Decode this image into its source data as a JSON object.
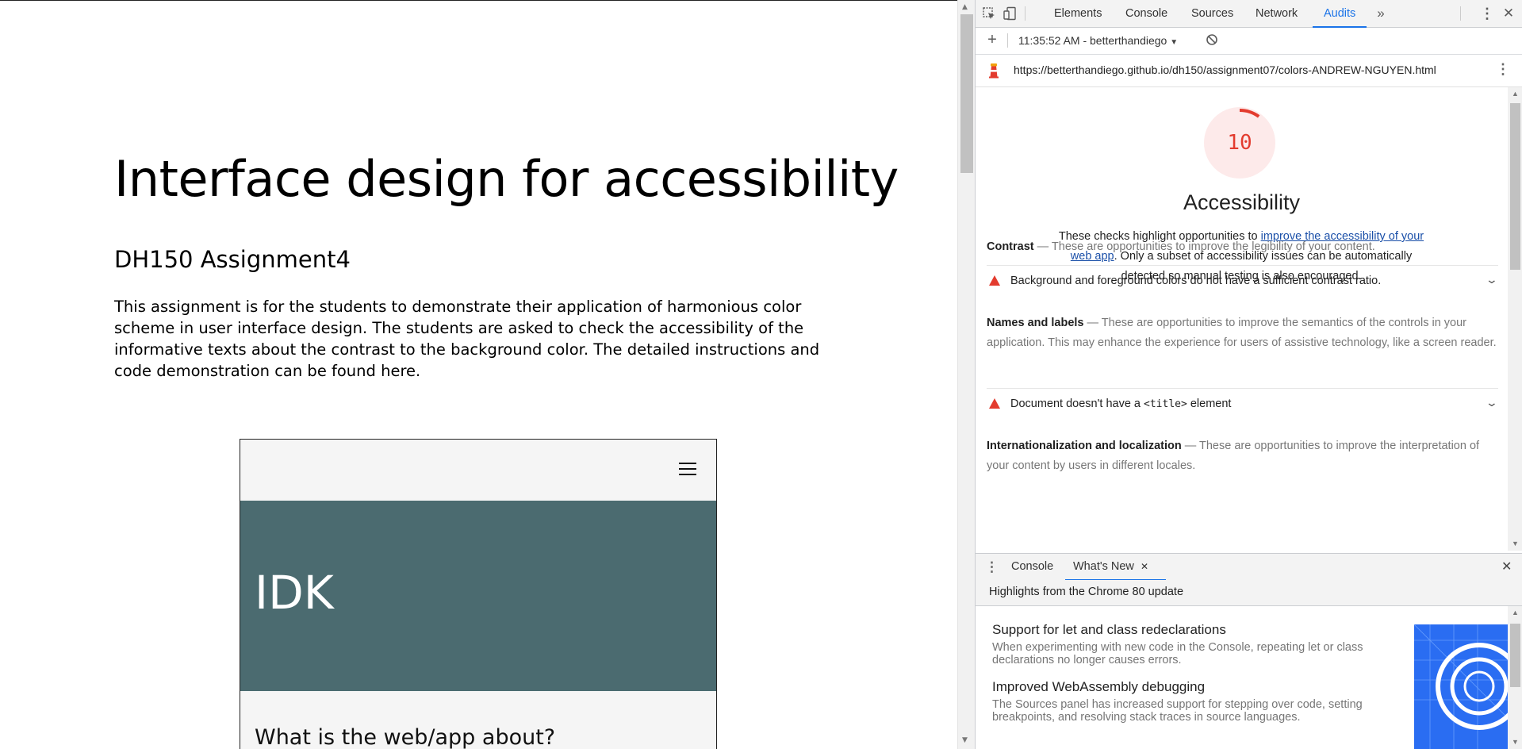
{
  "page": {
    "title": "Interface design for accessibility",
    "subtitle": "DH150 Assignment4",
    "body": "This assignment is for the students to demonstrate their application of harmonious color scheme in user interface design. The students are asked to check the accessibility of the informative texts about the contrast to the background color. The detailed instructions and code demonstration can be found here.",
    "mockup": {
      "hero_title": "IDK",
      "section_title": "What is the web/app about?",
      "hero_color": "#4b6b70"
    }
  },
  "devtools": {
    "tabs": [
      "Elements",
      "Console",
      "Sources",
      "Network",
      "Audits"
    ],
    "active_tab": "Audits",
    "report_selector": "11:35:52 AM - betterthandiego",
    "url": "https://betterthandiego.github.io/dh150/assignment07/colors-ANDREW-NGUYEN.html",
    "score": "10",
    "score_color": "#e33b2e",
    "category_title": "Accessibility",
    "category_desc_pre": "These checks highlight opportunities to ",
    "category_desc_link": "improve the accessibility of your web app",
    "category_desc_post": ". Only a subset of accessibility issues can be automatically detected so manual testing is also encouraged.",
    "groups": [
      {
        "title": "Contrast",
        "desc": "These are opportunities to improve the legibility of your content.",
        "audit": "Background and foreground colors do not have a sufficient contrast ratio."
      },
      {
        "title": "Names and labels",
        "desc": "These are opportunities to improve the semantics of the controls in your application. This may enhance the experience for users of assistive technology, like a screen reader.",
        "audit_pre": "Document doesn't have a ",
        "audit_code": "<title>",
        "audit_post": " element"
      },
      {
        "title": "Internationalization and localization",
        "desc": "These are opportunities to improve the interpretation of your content by users in different locales."
      }
    ],
    "drawer": {
      "tabs": [
        "Console",
        "What's New"
      ],
      "active_tab": "What's New",
      "subtitle": "Highlights from the Chrome 80 update",
      "items": [
        {
          "title": "Support for let and class redeclarations",
          "desc": "When experimenting with new code in the Console, repeating let or class declarations no longer causes errors."
        },
        {
          "title": "Improved WebAssembly debugging",
          "desc": "The Sources panel has increased support for stepping over code, setting breakpoints, and resolving stack traces in source languages."
        }
      ]
    }
  }
}
